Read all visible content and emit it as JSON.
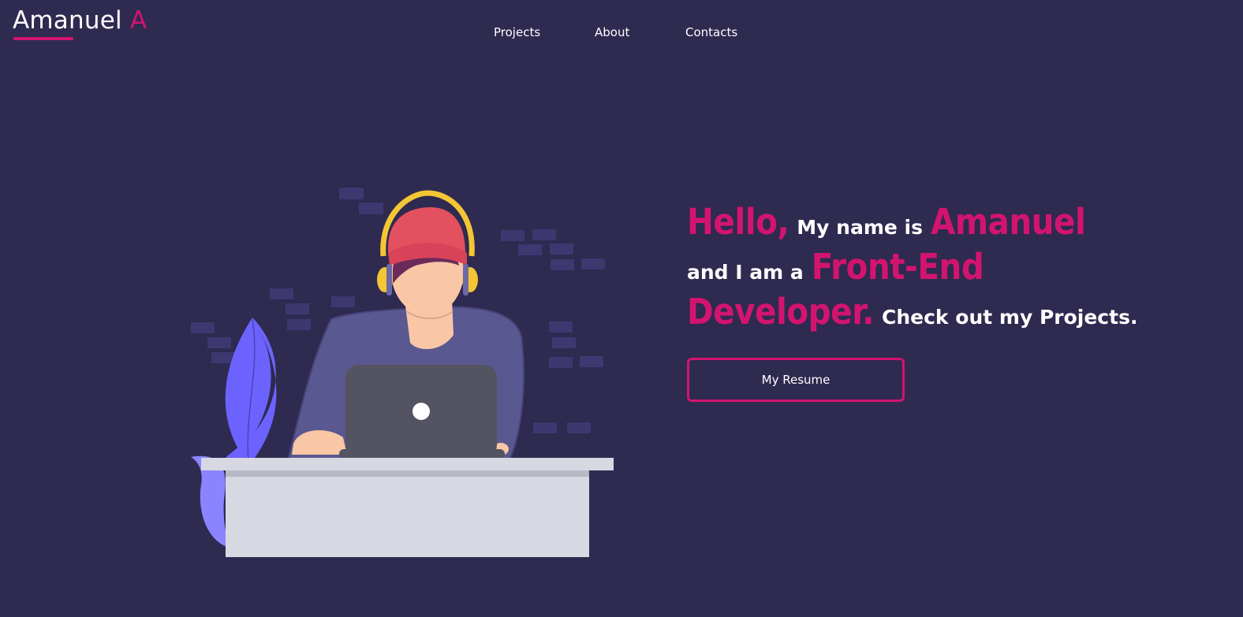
{
  "header": {
    "logo_name": "Amanuel",
    "logo_initial": "A",
    "nav": [
      "Projects",
      "About",
      "Contacts"
    ]
  },
  "intro": {
    "hello": "Hello,",
    "my_name_is": "My name is",
    "name": "Amanuel",
    "and_i_am_a": "and I am a",
    "role_1": "Front-End",
    "role_2": "Developer.",
    "check_out": "Check out my Projects."
  },
  "resume_button": "My Resume",
  "colors": {
    "background": "#2e2a50",
    "accent": "#d3146f",
    "text": "#ffffff"
  },
  "illustration": "developer-at-laptop"
}
